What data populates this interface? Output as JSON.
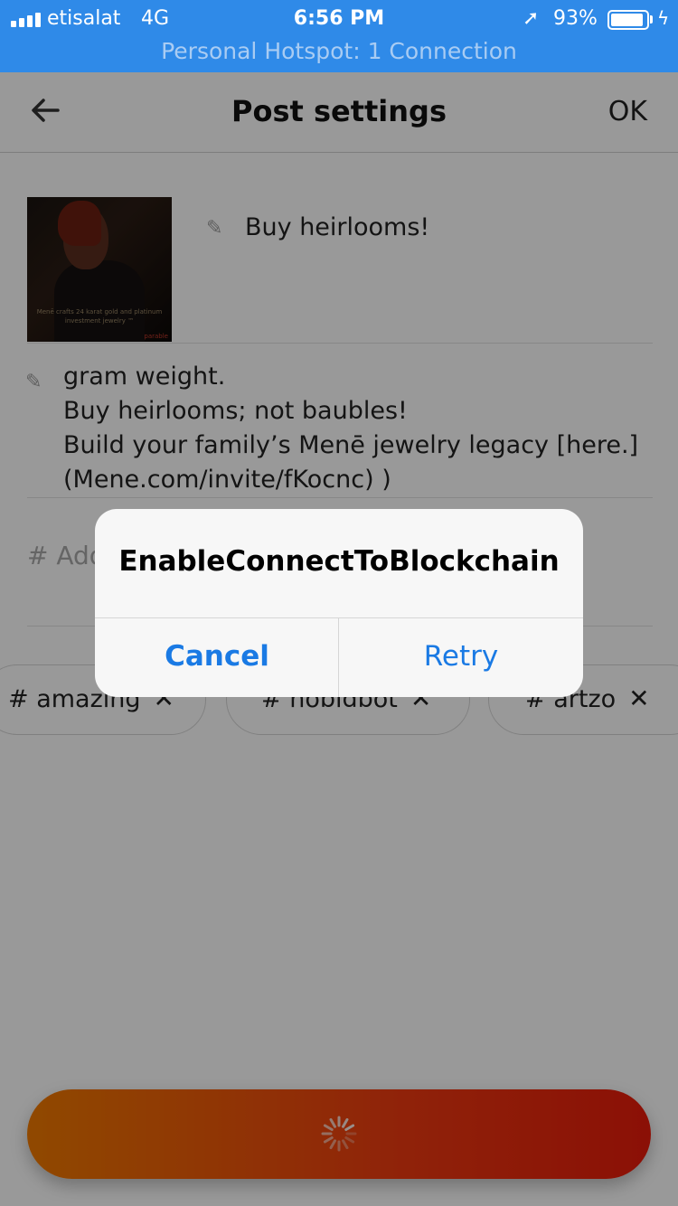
{
  "status_bar": {
    "carrier": "etisalat",
    "network": "4G",
    "time": "6:56 PM",
    "battery": "93%",
    "battery_level": 0.93,
    "hotspot": "Personal Hotspot: 1 Connection"
  },
  "nav": {
    "title": "Post settings",
    "ok_label": "OK"
  },
  "post": {
    "thumbnail_caption": "Menē crafts 24 karat gold and platinum investment jewelry ™",
    "thumbnail_brand": "parable",
    "title": "Buy heirlooms!",
    "description_lines": [
      "gram weight.",
      "Buy heirlooms; not baubles!",
      "Build your family’s Menē jewelry legacy [here.]",
      "(Mene.com/invite/fKocnc) )"
    ],
    "hashtag_placeholder": "# Add"
  },
  "tags": [
    {
      "label": "# amazing"
    },
    {
      "label": "# nobidbot"
    },
    {
      "label": "# artzo"
    }
  ],
  "alert": {
    "title": "EnableConnectToBlockchain",
    "cancel_label": "Cancel",
    "retry_label": "Retry"
  },
  "colors": {
    "status_bar": "#2f8ae8",
    "alert_button": "#1a7ae4",
    "cta_start": "#f07a00",
    "cta_end": "#e81b0a"
  }
}
